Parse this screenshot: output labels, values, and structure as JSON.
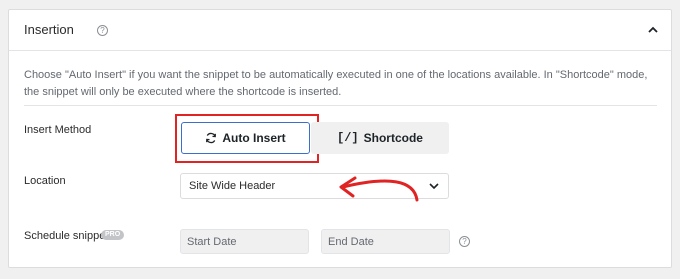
{
  "header": {
    "title": "Insertion",
    "help_icon": "?",
    "collapse_icon": "chevron-up-icon"
  },
  "description": "Choose \"Auto Insert\" if you want the snippet to be automatically executed in one of the locations available. In \"Shortcode\" mode, the snippet will only be executed where the shortcode is inserted.",
  "insert_method": {
    "label": "Insert Method",
    "auto_insert_label": "Auto Insert",
    "auto_insert_icon": "refresh-icon",
    "shortcode_icon_text": "[/]",
    "shortcode_label": "Shortcode",
    "selected": "Auto Insert"
  },
  "location": {
    "label": "Location",
    "selected_value": "Site Wide Header"
  },
  "schedule": {
    "label": "Schedule snippet",
    "badge": "PRO",
    "start_placeholder": "Start Date",
    "end_placeholder": "End Date",
    "help_icon": "?"
  },
  "colors": {
    "highlight_red": "#e02424",
    "accent_blue": "#3c6ed0"
  }
}
